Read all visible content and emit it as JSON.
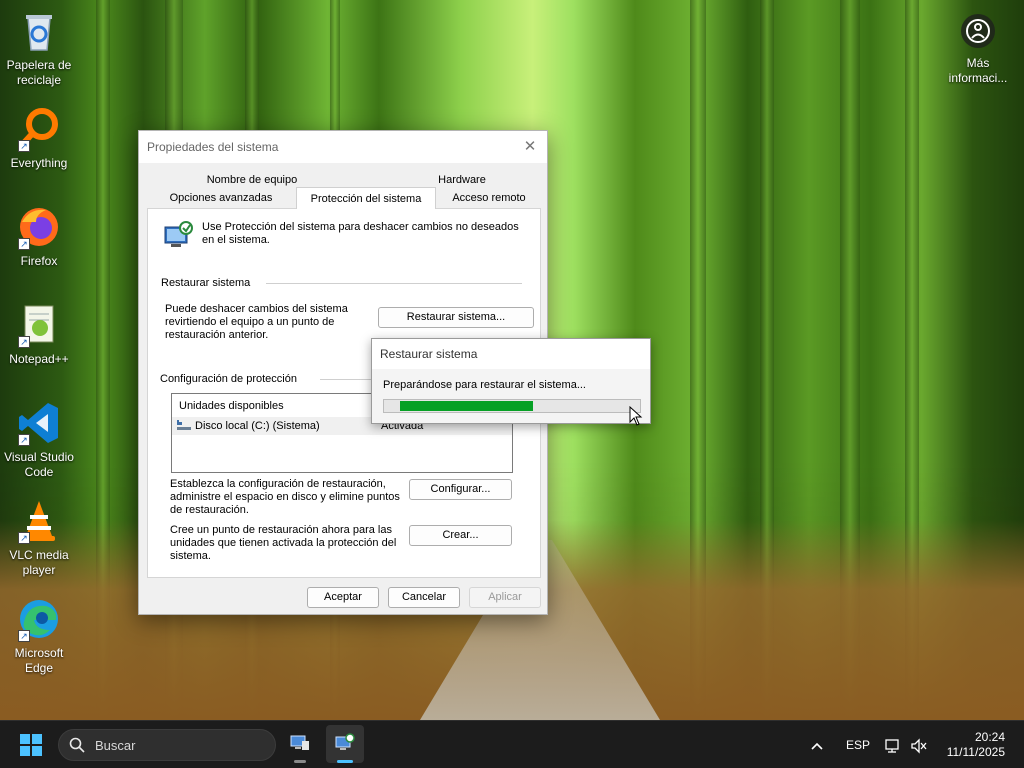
{
  "desktop": {
    "icons": [
      {
        "label": "Papelera de reciclaje",
        "icon": "recycle-bin-icon"
      },
      {
        "label": "Everything",
        "icon": "everything-search-icon"
      },
      {
        "label": "Firefox",
        "icon": "firefox-icon"
      },
      {
        "label": "Notepad++",
        "icon": "notepadpp-icon"
      },
      {
        "label": "Visual Studio Code",
        "icon": "vscode-icon"
      },
      {
        "label": "VLC media player",
        "icon": "vlc-icon"
      },
      {
        "label": "Microsoft Edge",
        "icon": "edge-icon"
      }
    ],
    "more_info": {
      "label": "Más informaci...",
      "icon": "info-circle-icon"
    }
  },
  "window": {
    "title": "Propiedades del sistema",
    "tabs": {
      "computer_name": "Nombre de equipo",
      "hardware": "Hardware",
      "advanced": "Opciones avanzadas",
      "system_protection": "Protección del sistema",
      "remote": "Acceso remoto"
    },
    "intro": "Use Protección del sistema para deshacer cambios no deseados en el sistema.",
    "restore_group": {
      "title": "Restaurar sistema",
      "description": "Puede deshacer cambios del sistema revirtiendo el equipo a un punto de restauración anterior.",
      "button": "Restaurar sistema..."
    },
    "protection_group": {
      "title": "Configuración de protección",
      "column_drives": "Unidades disponibles",
      "rows": [
        {
          "drive": "Disco local (C:) (Sistema)",
          "status": "Activada"
        }
      ],
      "configure_text": "Establezca la configuración de restauración, administre el espacio en disco y elimine puntos de restauración.",
      "configure_button": "Configurar...",
      "create_text": "Cree un punto de restauración ahora para las unidades que tienen activada la protección del sistema.",
      "create_button": "Crear..."
    },
    "buttons": {
      "ok": "Aceptar",
      "cancel": "Cancelar",
      "apply": "Aplicar"
    }
  },
  "popup": {
    "title": "Restaurar sistema",
    "message": "Preparándose para restaurar el sistema...",
    "progress": 0.52
  },
  "taskbar": {
    "search_placeholder": "Buscar",
    "language": "ESP",
    "time": "20:24",
    "date": "11/11/2025"
  },
  "colors": {
    "progress": "#06a025",
    "accent": "#4cc2ff"
  }
}
